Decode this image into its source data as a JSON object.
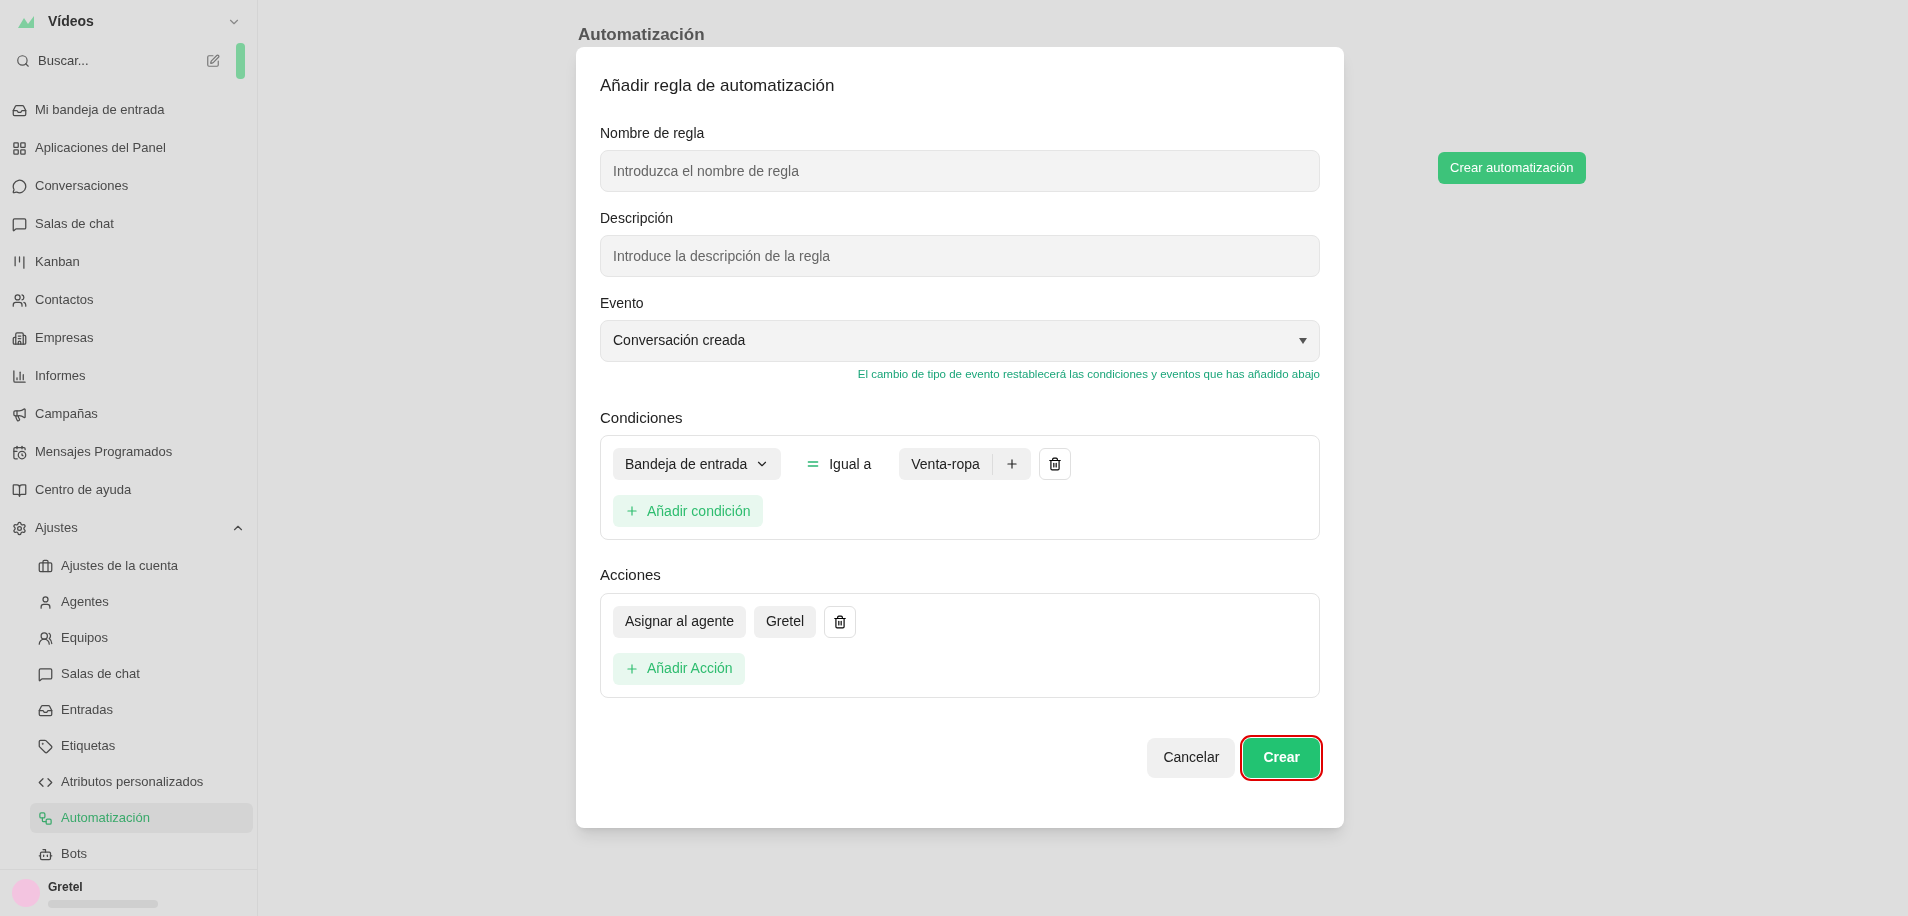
{
  "sidebar": {
    "workspace": "Vídeos",
    "search": {
      "placeholder": "Buscar..."
    },
    "items": [
      {
        "label": "Mi bandeja de entrada",
        "selected": false
      },
      {
        "label": "Aplicaciones del Panel",
        "selected": false
      },
      {
        "label": "Conversaciones",
        "selected": false
      },
      {
        "label": "Salas de chat",
        "selected": false
      },
      {
        "label": "Kanban",
        "selected": false
      },
      {
        "label": "Contactos",
        "selected": false
      },
      {
        "label": "Empresas",
        "selected": false
      },
      {
        "label": "Informes",
        "selected": false
      },
      {
        "label": "Campañas",
        "selected": false
      },
      {
        "label": "Mensajes Programados",
        "selected": false
      },
      {
        "label": "Centro de ayuda",
        "selected": false
      },
      {
        "label": "Ajustes",
        "selected": false,
        "expanded": true,
        "children": [
          {
            "label": "Ajustes de la cuenta",
            "selected": false
          },
          {
            "label": "Agentes",
            "selected": false
          },
          {
            "label": "Equipos",
            "selected": false
          },
          {
            "label": "Salas de chat",
            "selected": false
          },
          {
            "label": "Entradas",
            "selected": false
          },
          {
            "label": "Etiquetas",
            "selected": false
          },
          {
            "label": "Atributos personalizados",
            "selected": false
          },
          {
            "label": "Automatización",
            "selected": true
          },
          {
            "label": "Bots",
            "selected": false
          }
        ]
      }
    ],
    "user": {
      "name": "Gretel"
    }
  },
  "page": {
    "title": "Automatización",
    "create_button": "Crear automatización"
  },
  "dialog": {
    "title": "Añadir regla de automatización",
    "name_field": {
      "label": "Nombre de regla",
      "placeholder": "Introduzca el nombre de regla"
    },
    "description_field": {
      "label": "Descripción",
      "placeholder": "Introduce la descripción de la regla"
    },
    "event_field": {
      "label": "Evento",
      "value": "Conversación creada",
      "hint": "El cambio de tipo de evento restablecerá las condiciones y eventos que has añadido abajo"
    },
    "conditions": {
      "label": "Condiciones",
      "rows": [
        {
          "attribute": "Bandeja de entrada",
          "operator": "Igual a",
          "value": "Venta-ropa"
        }
      ],
      "add_button": "Añadir condición"
    },
    "actions": {
      "label": "Acciones",
      "rows": [
        {
          "action": "Asignar al agente",
          "value": "Gretel"
        }
      ],
      "add_button": "Añadir Acción"
    },
    "buttons": {
      "cancel": "Cancelar",
      "create": "Crear"
    }
  }
}
